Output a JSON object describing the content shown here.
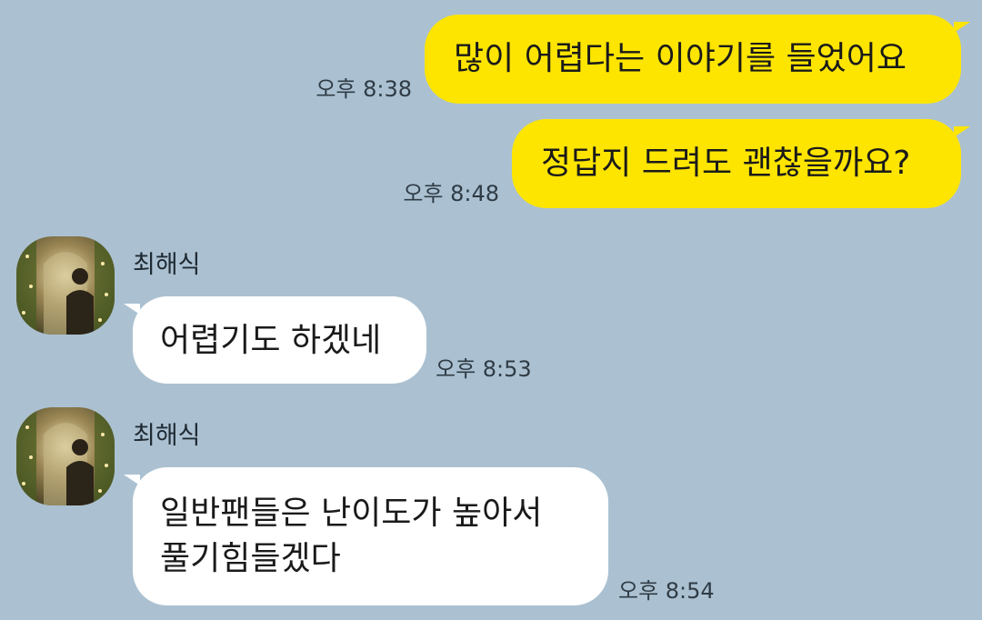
{
  "messages": [
    {
      "direction": "outgoing",
      "text": "많이 어렵다는 이야기를 들었어요",
      "time": "오후 8:38"
    },
    {
      "direction": "outgoing",
      "text": "정답지 드려도 괜찮을까요?",
      "time": "오후 8:48"
    },
    {
      "direction": "incoming",
      "sender": "최해식",
      "text": "어렵기도 하겠네",
      "time": "오후 8:53"
    },
    {
      "direction": "incoming",
      "sender": "최해식",
      "lines": [
        "일반팬들은 난이도가 높아서",
        "풀기힘들겠다"
      ],
      "time": "오후 8:54"
    }
  ],
  "colors": {
    "background": "#abc1d1",
    "outgoing_bubble": "#fee500",
    "incoming_bubble": "#ffffff"
  },
  "icons": {
    "avatar": "profile-photo-avatar"
  }
}
